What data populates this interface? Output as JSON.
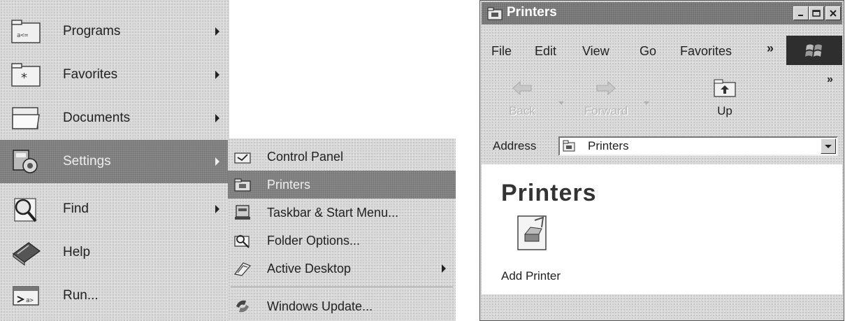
{
  "start_menu": {
    "items": [
      {
        "label": "Programs",
        "icon": "programs-folder-icon",
        "submenu": true
      },
      {
        "label": "Favorites",
        "icon": "favorites-folder-icon",
        "submenu": true
      },
      {
        "label": "Documents",
        "icon": "documents-folder-icon",
        "submenu": true
      },
      {
        "label": "Settings",
        "icon": "settings-icon",
        "submenu": true,
        "selected": true
      },
      {
        "label": "Find",
        "icon": "find-magnifier-icon",
        "submenu": true
      },
      {
        "label": "Help",
        "icon": "help-book-icon",
        "submenu": false
      },
      {
        "label": "Run...",
        "icon": "run-icon",
        "submenu": false
      }
    ]
  },
  "settings_submenu": {
    "items": [
      {
        "label": "Control Panel",
        "icon": "control-panel-icon"
      },
      {
        "label": "Printers",
        "icon": "printers-folder-icon",
        "selected": true
      },
      {
        "label": "Taskbar & Start Menu...",
        "icon": "taskbar-icon"
      },
      {
        "label": "Folder Options...",
        "icon": "folder-options-icon"
      },
      {
        "label": "Active Desktop",
        "icon": "active-desktop-icon",
        "submenu": true
      },
      {
        "label": "Windows Update...",
        "icon": "windows-update-icon"
      }
    ]
  },
  "window": {
    "title": "Printers",
    "menu": [
      "File",
      "Edit",
      "View",
      "Go",
      "Favorites"
    ],
    "menu_more": "»",
    "toolbar": [
      {
        "label": "Back",
        "icon": "back-arrow-icon",
        "enabled": false
      },
      {
        "label": "Forward",
        "icon": "forward-arrow-icon",
        "enabled": false
      },
      {
        "label": "Up",
        "icon": "up-folder-icon",
        "enabled": true
      }
    ],
    "toolbar_more": "»",
    "address_label": "Address",
    "address_value": "Printers",
    "folder_heading": "Printers",
    "items": [
      {
        "label": "Add Printer",
        "icon": "add-printer-icon"
      }
    ]
  }
}
